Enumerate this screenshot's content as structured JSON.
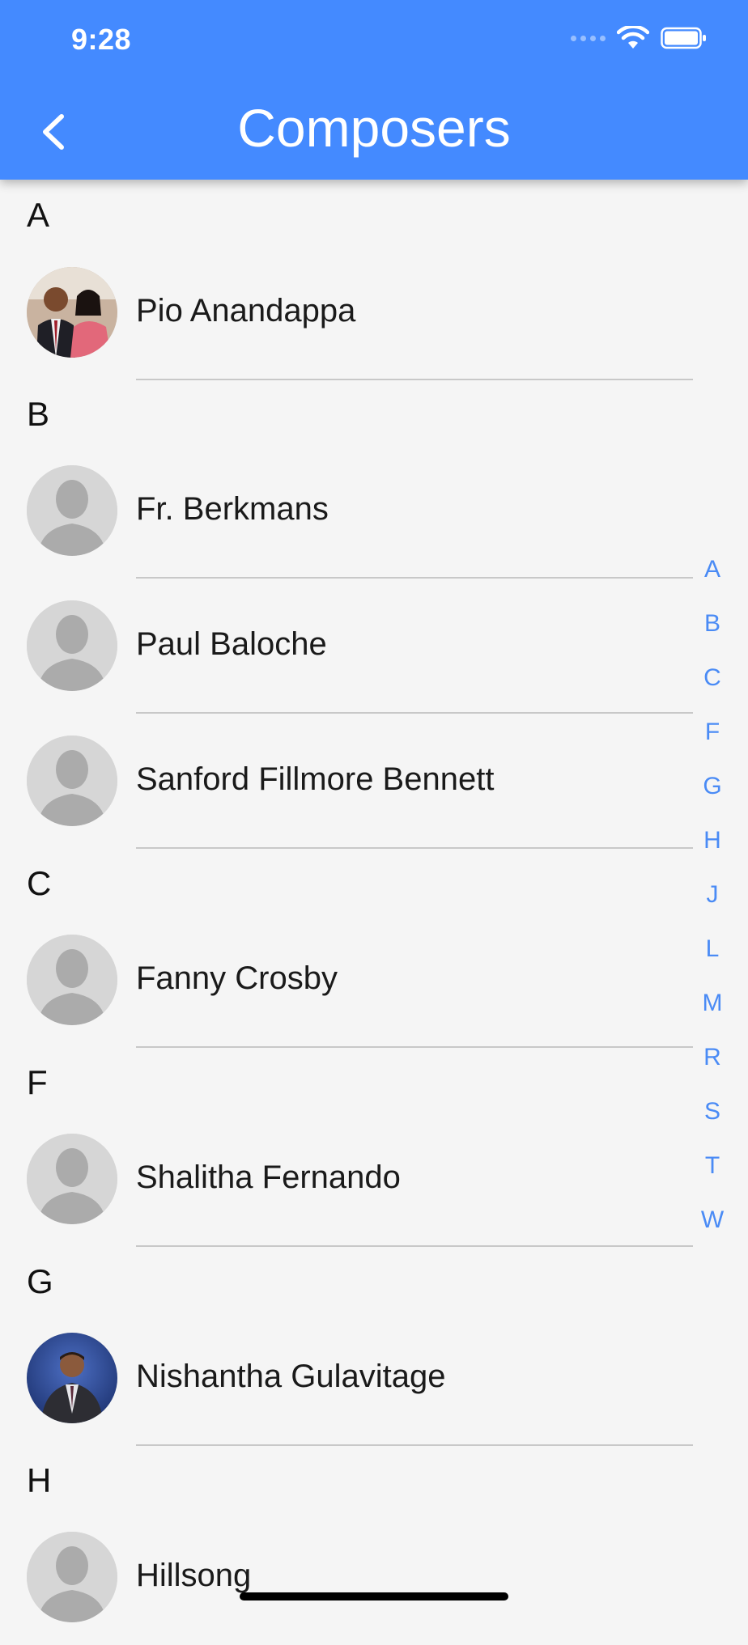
{
  "status_bar": {
    "time": "9:28",
    "icons": [
      "signal-icon",
      "wifi-icon",
      "battery-icon"
    ]
  },
  "app_bar": {
    "title": "Composers",
    "back_icon": "chevron-left-icon",
    "color": "#448aff"
  },
  "sections": [
    {
      "letter": "A",
      "items": [
        {
          "name": "Pio Anandappa",
          "avatar": "photo-couple"
        }
      ]
    },
    {
      "letter": "B",
      "items": [
        {
          "name": "Fr. Berkmans",
          "avatar": "placeholder"
        },
        {
          "name": "Paul Baloche",
          "avatar": "placeholder"
        },
        {
          "name": "Sanford Fillmore Bennett",
          "avatar": "placeholder"
        }
      ]
    },
    {
      "letter": "C",
      "items": [
        {
          "name": "Fanny Crosby",
          "avatar": "placeholder"
        }
      ]
    },
    {
      "letter": "F",
      "items": [
        {
          "name": "Shalitha Fernando",
          "avatar": "placeholder"
        }
      ]
    },
    {
      "letter": "G",
      "items": [
        {
          "name": "Nishantha Gulavitage",
          "avatar": "photo-man-suit"
        }
      ]
    },
    {
      "letter": "H",
      "items": [
        {
          "name": "Hillsong",
          "avatar": "placeholder"
        }
      ]
    }
  ],
  "index_letters": [
    "A",
    "B",
    "C",
    "F",
    "G",
    "H",
    "J",
    "L",
    "M",
    "R",
    "S",
    "T",
    "W"
  ],
  "colors": {
    "accent": "#448aff",
    "index_text": "#4a8bf5",
    "background": "#f5f5f5"
  }
}
